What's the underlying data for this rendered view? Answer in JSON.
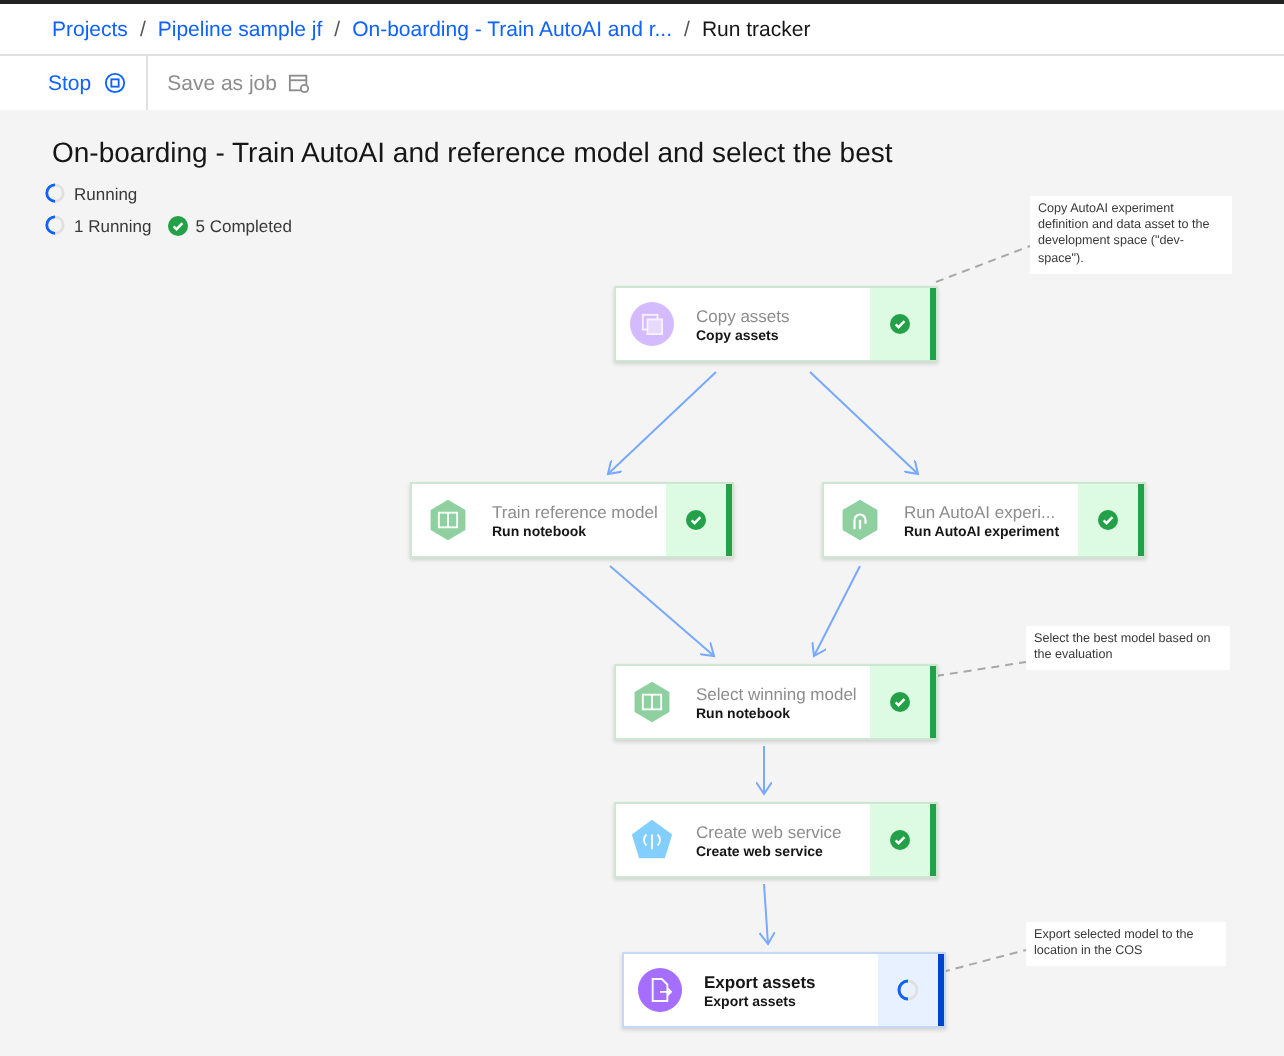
{
  "breadcrumbs": [
    {
      "label": "Projects",
      "link": true
    },
    {
      "separator": "/",
      "label": "Pipeline sample jf",
      "link": true
    },
    {
      "separator": "/",
      "label": "On-boarding - Train AutoAI and r...",
      "link": true
    },
    {
      "separator": "/",
      "label": "Run tracker",
      "link": false
    }
  ],
  "toolbar": [
    {
      "label": "Stop",
      "disabled": false,
      "kind": "stop"
    },
    {
      "label": "Save as job",
      "disabled": true,
      "kind": "job"
    }
  ],
  "title": "On-boarding - Train AutoAI and reference model and select the best",
  "run_status": "Running",
  "counts": [
    {
      "kind": "running",
      "label": "1 Running"
    },
    {
      "kind": "completed",
      "label": "5 Completed"
    }
  ],
  "nodes": [
    {
      "title": "Copy assets",
      "subtitle": "Copy assets",
      "kind": "copy",
      "running": false
    },
    {
      "title": "Train reference model",
      "subtitle": "Run notebook",
      "kind": "notebook",
      "running": false
    },
    {
      "title": "Run AutoAI experi...",
      "subtitle": "Run AutoAI experiment",
      "kind": "autoai",
      "running": false
    },
    {
      "title": "Select winning model",
      "subtitle": "Run notebook",
      "kind": "notebook",
      "running": false
    },
    {
      "title": "Create web service",
      "subtitle": "Create web service",
      "kind": "web",
      "running": false
    },
    {
      "title": "Export assets",
      "subtitle": "Export assets",
      "kind": "export",
      "running": true
    }
  ],
  "notes": [
    {
      "text": "Copy AutoAI experiment definition and data asset to the development space (\"dev-space\")."
    },
    {
      "text": "Select the best model based on the evaluation"
    },
    {
      "text": "Export selected model to the location in the COS"
    }
  ]
}
